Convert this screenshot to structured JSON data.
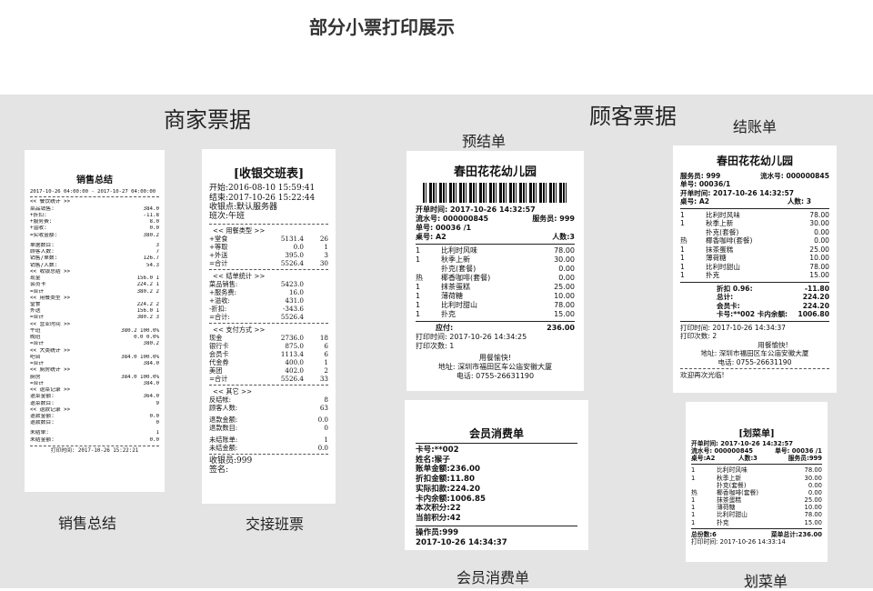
{
  "page_title": "部分小票打印展示",
  "sections": {
    "merchant": "商家票据",
    "customer": "顾客票据"
  },
  "captions": {
    "sales": "销售总结",
    "shift": "交接班票",
    "prebill": "预结单",
    "checkout": "结账单",
    "member": "会员消费单",
    "cancel": "划菜单"
  },
  "sales": {
    "title": "销售总结",
    "range": "2017-10-26 04:00:00 - 2017-10-27 04:00:00",
    "lines": [
      [
        "<< 餐饮统计 >>",
        ""
      ],
      [
        "菜品销售:",
        "384.0"
      ],
      [
        "+折扣:",
        "-11.8"
      ],
      [
        "+服务费:",
        "8.0"
      ],
      [
        "+溢收:",
        "0.0"
      ],
      [
        "=实收金额:",
        "380.2"
      ],
      [
        "",
        ""
      ],
      [
        "单据数目:",
        "3"
      ],
      [
        "顾客人数:",
        "7"
      ],
      [
        "销售/单数:",
        "126.7"
      ],
      [
        "销售/人数:",
        "54.3"
      ],
      [
        "<< 收银总结 >>",
        ""
      ],
      [
        "现金",
        "156.0  1"
      ],
      [
        "会员卡",
        "224.2  1"
      ],
      [
        "=合计",
        "380.2  2"
      ],
      [
        "<< 用餐类型 >>",
        ""
      ],
      [
        "堂食",
        "224.2  2"
      ],
      [
        "外送",
        "156.0  1"
      ],
      [
        "=合计",
        "380.2  3"
      ],
      [
        "<< 营业时间 >>",
        ""
      ],
      [
        "午班",
        "380.2 100.0%"
      ],
      [
        "晚班",
        "0.0  0.0%"
      ],
      [
        "=合计",
        "380.2"
      ],
      [
        "<< 大类统计 >>",
        ""
      ],
      [
        "吧台",
        "384.0 100.0%"
      ],
      [
        "=合计",
        "384.0"
      ],
      [
        "<< 厨房统计 >>",
        ""
      ],
      [
        "厨房",
        "384.0 100.0%"
      ],
      [
        "=合计",
        "384.0"
      ],
      [
        "<< 退菜记录 >>",
        ""
      ],
      [
        "退菜金额:",
        "364.0"
      ],
      [
        "退菜数目:",
        "9"
      ],
      [
        "<< 退款记录 >>",
        ""
      ],
      [
        "退款金额:",
        "0.0"
      ],
      [
        "退款数目:",
        "0"
      ],
      [
        "",
        ""
      ],
      [
        "未结单:",
        "1"
      ],
      [
        "未结金额:",
        "0.0"
      ]
    ],
    "print_time": "打印时间: 2017-10-26 15:22:21"
  },
  "shift": {
    "title": "[收银交班表]",
    "header": [
      "开始:2016-08-10 15:59:41",
      "结束:2017-10-26 15:22:44",
      "收银点:默认服务器",
      "班次:午班"
    ],
    "sections": [
      {
        "head": "<< 用餐类型 >>",
        "rows": [
          [
            "+堂食",
            "5131.4",
            "26"
          ],
          [
            "+等取",
            "0.0",
            "1"
          ],
          [
            "+外送",
            "395.0",
            "3"
          ],
          [
            "=合计",
            "5526.4",
            "30"
          ]
        ]
      },
      {
        "head": "<< 结单统计 >>",
        "rows": [
          [
            "菜品销售:",
            "5423.0",
            ""
          ],
          [
            "+服务费:",
            "16.0",
            ""
          ],
          [
            "+溢收:",
            "431.0",
            ""
          ],
          [
            "-折扣:",
            "-343.6",
            ""
          ],
          [
            "=合计:",
            "5526.4",
            ""
          ]
        ]
      },
      {
        "head": "<< 支付方式 >>",
        "rows": [
          [
            "现金",
            "2736.0",
            "18"
          ],
          [
            "银行卡",
            "875.0",
            "6"
          ],
          [
            "会员卡",
            "1113.4",
            "6"
          ],
          [
            "代金券",
            "400.0",
            "1"
          ],
          [
            "美团",
            "402.0",
            "2"
          ],
          [
            "=合计",
            "5526.4",
            "33"
          ]
        ]
      },
      {
        "head": "<< 其它 >>",
        "rows": [
          [
            "反结帐:",
            "",
            "8"
          ],
          [
            "顾客人数:",
            "",
            "63"
          ],
          [
            "",
            "",
            ""
          ],
          [
            "退款金额:",
            "",
            "0.0"
          ],
          [
            "退款数目:",
            "",
            "0"
          ],
          [
            "",
            "",
            ""
          ],
          [
            "未结账单:",
            "",
            "1"
          ],
          [
            "未结金额:",
            "",
            "0.0"
          ]
        ]
      }
    ],
    "footer": [
      "收银员:999",
      "签名:"
    ]
  },
  "prebill": {
    "title": "春田花花幼儿园",
    "open_time": "开单时间: 2017-10-26 14:32:57",
    "serial": "流水号: 000000845",
    "waiter": "服务员: 999",
    "bill_no": "单号:  00036 /1",
    "table": "桌号:  A2",
    "guests": "人数:3",
    "items": [
      [
        "1",
        "比利时风味",
        "78.00"
      ],
      [
        "1",
        "秋季上新",
        "30.00"
      ],
      [
        "",
        "   扑克(套餐)",
        "0.00"
      ],
      [
        "热",
        "   椰香咖啡(套餐)",
        "0.00"
      ],
      [
        "1",
        "抹茶蛋糕",
        "25.00"
      ],
      [
        "1",
        "薄荷糖",
        "10.00"
      ],
      [
        "1",
        "比利时甜山",
        "78.00"
      ],
      [
        "1",
        "扑克",
        "15.00"
      ]
    ],
    "due": "应付:",
    "due_amount": "236.00",
    "print_time": "打印时间: 2017-10-26 14:34:25",
    "print_count": "打印次数: 1",
    "thanks": "用餐愉快!",
    "address": "地址: 深圳市福田区车公庙安徽大厦",
    "phone": "电话: 0755-26631190"
  },
  "checkout": {
    "title": "春田花花幼儿园",
    "waiter": "服务员:  999",
    "serial": "流水号: 000000845",
    "bill_no": "单号:    00036/1",
    "open_time": "开单时间: 2017-10-26 14:32:57",
    "table": "桌号:    A2",
    "guests": "人数:  3",
    "items": [
      [
        "1",
        "比利时风味",
        "78.00"
      ],
      [
        "1",
        "秋季上新",
        "30.00"
      ],
      [
        "",
        "   扑克(套餐)",
        "0.00"
      ],
      [
        "热",
        "   椰香咖啡(套餐)",
        "0.00"
      ],
      [
        "1",
        "抹茶蛋糕",
        "25.00"
      ],
      [
        "1",
        "薄荷糖",
        "10.00"
      ],
      [
        "1",
        "比利时甜山",
        "78.00"
      ],
      [
        "1",
        "扑克",
        "15.00"
      ]
    ],
    "totals": [
      [
        "折扣 0.96:",
        "-11.80"
      ],
      [
        "总计:",
        "224.20"
      ],
      [
        "会员卡:",
        "224.20"
      ],
      [
        "卡号:**002  卡内余额:",
        "1006.80"
      ]
    ],
    "print_time": "打印时间: 2017-10-26 14:34:37",
    "print_count": "打印次数:  2",
    "thanks": "用餐愉快!",
    "address": "地址: 深圳市福田区车公庙安徽大厦",
    "phone": "电话: 0755-26631190",
    "welcome": "欢迎再次光临!"
  },
  "member": {
    "title": "会员消费单",
    "lines": [
      "卡号:**002",
      "姓名:猴子",
      "账单金额:236.00",
      "折扣金额:11.80",
      "实际扣款:224.20",
      "卡内余额:1006.85",
      "本次积分:22",
      "当前积分:42"
    ],
    "operator": "操作员:999",
    "time": "2017-10-26 14:34:37"
  },
  "cancel": {
    "title": "[划菜单]",
    "open_time": "开单时间: 2017-10-26 14:32:57",
    "serial": "流水号: 000000845",
    "bill_no": "单号: 00036 /1",
    "table": "桌号:A2",
    "guests": "人数:3",
    "waiter": "服务员:999",
    "items": [
      [
        "1",
        "比利时风味",
        "78.00"
      ],
      [
        "1",
        "秋季上新",
        "30.00"
      ],
      [
        "",
        "   扑克(套餐)",
        "0.00"
      ],
      [
        "热",
        "   椰香咖啡(套餐)",
        "0.00"
      ],
      [
        "1",
        "抹茶蛋糕",
        "25.00"
      ],
      [
        "1",
        "薄荷糖",
        "10.00"
      ],
      [
        "1",
        "比利时甜山",
        "78.00"
      ],
      [
        "1",
        "扑克",
        "15.00"
      ]
    ],
    "count": "总份数:6",
    "total": "菜单总计:236.00",
    "print_time": "打印时间:  2017-10-26 14:33:14"
  }
}
